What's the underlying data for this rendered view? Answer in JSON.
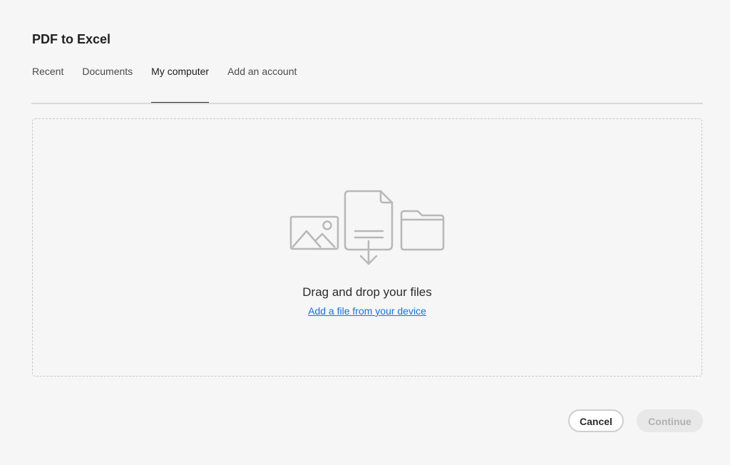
{
  "dialog": {
    "title": "PDF to Excel"
  },
  "tabs": [
    {
      "label": "Recent",
      "selected": false
    },
    {
      "label": "Documents",
      "selected": false
    },
    {
      "label": "My computer",
      "selected": true
    },
    {
      "label": "Add an account",
      "selected": false
    }
  ],
  "dropzone": {
    "heading": "Drag and drop your files",
    "link_label": "Add a file from your device",
    "icons": [
      "image-icon",
      "document-download-icon",
      "folder-icon"
    ]
  },
  "footer": {
    "cancel_label": "Cancel",
    "continue_label": "Continue",
    "continue_enabled": false
  },
  "colors": {
    "background": "#f6f6f6",
    "link": "#1473e6",
    "icon_stroke": "#b8b8b8",
    "disabled_button": "#e8e8e8"
  }
}
